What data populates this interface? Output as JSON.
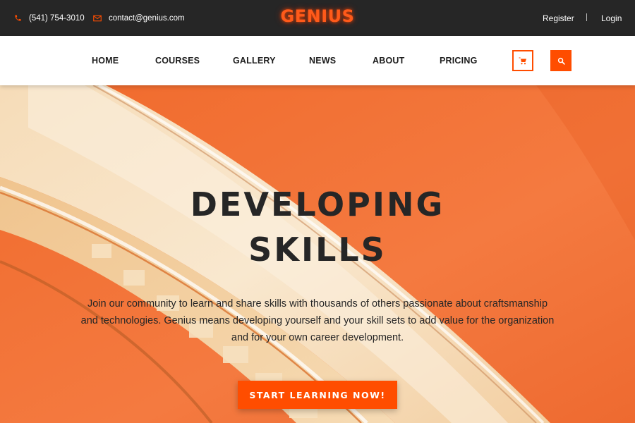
{
  "topbar": {
    "phone": "(541) 754-3010",
    "email": "contact@genius.com",
    "logo": "GENIUS",
    "register": "Register",
    "login": "Login"
  },
  "nav": {
    "items": [
      {
        "label": "HOME"
      },
      {
        "label": "COURSES"
      },
      {
        "label": "GALLERY"
      },
      {
        "label": "NEWS"
      },
      {
        "label": "ABOUT"
      },
      {
        "label": "PRICING"
      }
    ],
    "cart_icon": "cart-icon",
    "search_icon": "search-icon"
  },
  "hero": {
    "title_line1": "DEVELOPING",
    "title_line2": "SKILLS",
    "text_line1": "Join our community to learn and share skills with thousands of others passionate about craftsmanship",
    "text_line2": "and technologies. Genius means developing yourself and your skill sets to add value for the organization",
    "text_line3": "and for your own career development.",
    "cta": "START LEARNING NOW!"
  },
  "colors": {
    "accent": "#ff4d00",
    "topbar_bg": "#262626",
    "text_dark": "#262626",
    "hero_orange": "#f47236",
    "hero_cream": "#f8e6cc"
  }
}
